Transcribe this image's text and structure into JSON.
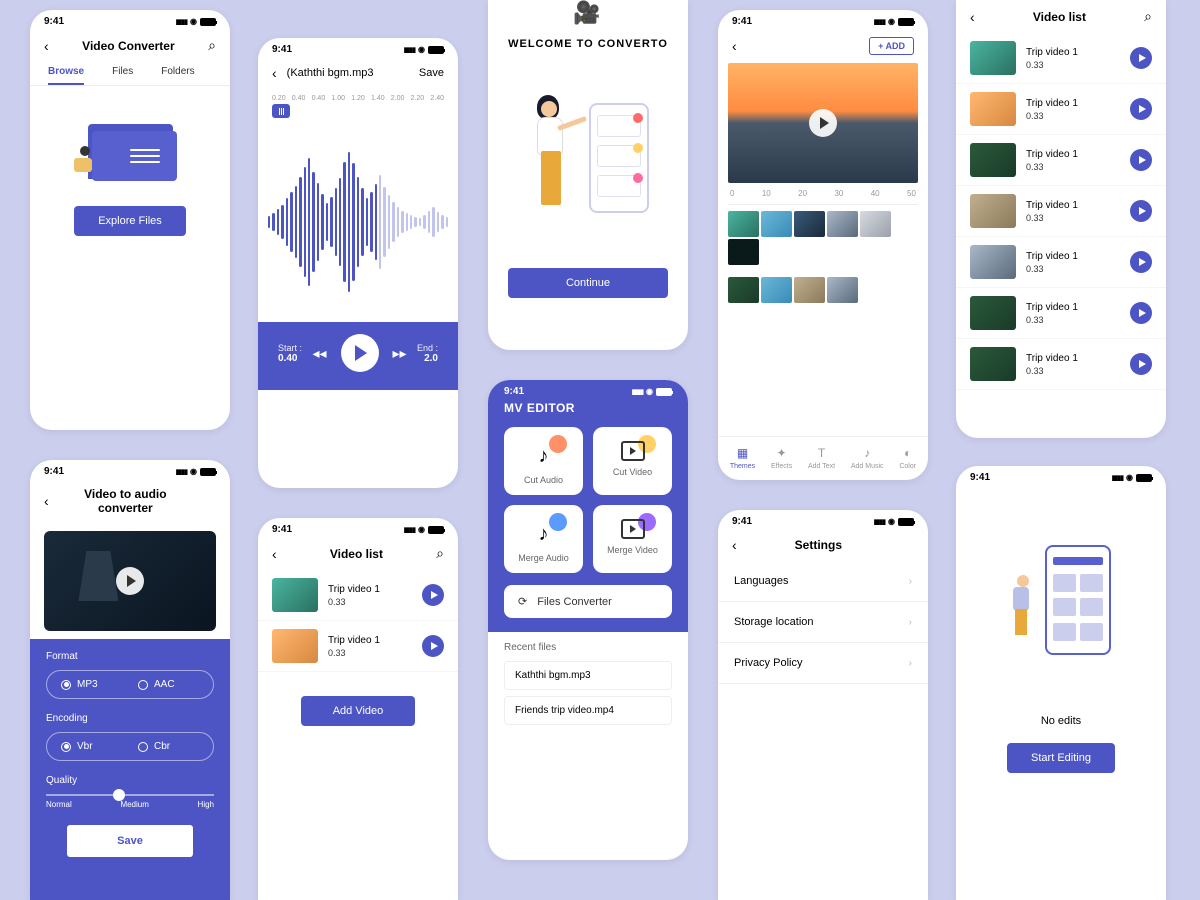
{
  "status_time": "9:41",
  "colors": {
    "primary": "#4d55c5",
    "bg": "#cbceed"
  },
  "screen1": {
    "title": "Video Converter",
    "tabs": [
      "Browse",
      "Files",
      "Folders"
    ],
    "cta": "Explore Files"
  },
  "screen2": {
    "file": "(Kaththi bgm.mp3",
    "save": "Save",
    "ticks": [
      "0.20",
      "0.40",
      "0.40",
      "1.00",
      "1.20",
      "1.40",
      "2.00",
      "2.20",
      "2.40"
    ],
    "start_label": "Start :",
    "start_val": "0.40",
    "end_label": "End :",
    "end_val": "2.0"
  },
  "screen3": {
    "welcome": "WELCOME TO CONVERTO",
    "cta": "Continue"
  },
  "screen4": {
    "add": "+ ADD",
    "ruler": [
      "0",
      "10",
      "20",
      "30",
      "40",
      "50"
    ],
    "nav": [
      {
        "label": "Themes",
        "icon": "▦"
      },
      {
        "label": "Effects",
        "icon": "✦"
      },
      {
        "label": "Add Text",
        "icon": "T"
      },
      {
        "label": "Add Music",
        "icon": "♪"
      },
      {
        "label": "Color",
        "icon": "◐"
      }
    ]
  },
  "screen5": {
    "title": "Video list",
    "items": [
      {
        "title": "Trip video 1",
        "size": "0.33",
        "thumb": "g1"
      },
      {
        "title": "Trip video 1",
        "size": "0.33",
        "thumb": "g9"
      },
      {
        "title": "Trip video 1",
        "size": "0.33",
        "thumb": "g7"
      },
      {
        "title": "Trip video 1",
        "size": "0.33",
        "thumb": "g4"
      },
      {
        "title": "Trip video 1",
        "size": "0.33",
        "thumb": "g5"
      },
      {
        "title": "Trip video 1",
        "size": "0.33",
        "thumb": "g7"
      },
      {
        "title": "Trip video 1",
        "size": "0.33",
        "thumb": "g7"
      }
    ]
  },
  "screen6": {
    "title": "Video to audio converter",
    "format_label": "Format",
    "formats": [
      "MP3",
      "AAC"
    ],
    "encoding_label": "Encoding",
    "encodings": [
      "Vbr",
      "Cbr"
    ],
    "quality_label": "Quality",
    "quality_marks": [
      "Normal",
      "Medium",
      "High"
    ],
    "save": "Save"
  },
  "screen7": {
    "title": "Video list",
    "items": [
      {
        "title": "Trip video 1",
        "size": "0.33",
        "thumb": "g1"
      },
      {
        "title": "Trip video 1",
        "size": "0.33",
        "thumb": "g9"
      }
    ],
    "cta": "Add Video"
  },
  "screen8": {
    "title": "MV EDITOR",
    "cards": [
      {
        "label": "Cut Audio",
        "badge": "orange"
      },
      {
        "label": "Cut Video",
        "badge": "yellow"
      },
      {
        "label": "Merge Audio",
        "badge": "blue"
      },
      {
        "label": "Merge Video",
        "badge": "purple"
      }
    ],
    "converter": "Files Converter",
    "recent_label": "Recent files",
    "recent": [
      "Kaththi bgm.mp3",
      "Friends trip video.mp4"
    ]
  },
  "screen9": {
    "title": "Settings",
    "rows": [
      "Languages",
      "Storage location",
      "Privacy Policy"
    ]
  },
  "screen10": {
    "empty": "No edits",
    "cta": "Start Editing"
  }
}
